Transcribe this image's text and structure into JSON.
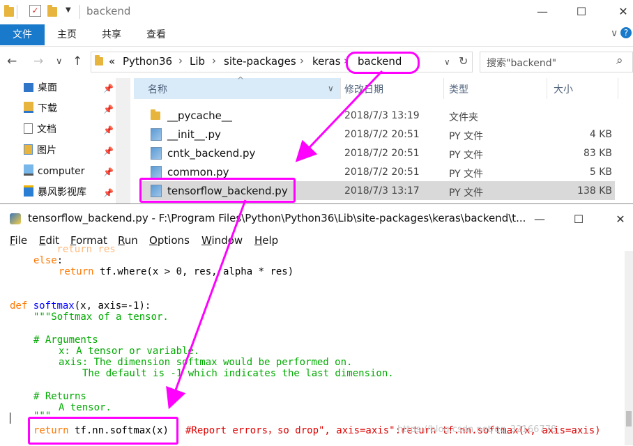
{
  "explorer": {
    "title": "backend",
    "window_controls": [
      "—",
      "☐",
      "✕"
    ],
    "ribbon": {
      "file_tab": "文件",
      "tabs": [
        "主页",
        "共享",
        "查看"
      ],
      "expand": "∨",
      "help": "?"
    },
    "nav": {
      "back": "←",
      "forward": "→",
      "recent": "∨",
      "up": "↑"
    },
    "address": {
      "overflow": "«",
      "crumbs": [
        "Python36",
        "Lib",
        "site-packages",
        "keras",
        "backend"
      ],
      "separator": "›",
      "dropdown": "∨",
      "refresh": "↻"
    },
    "search": {
      "placeholder": "搜索\"backend\"",
      "icon": "⌕"
    },
    "quick_access": [
      {
        "label": "桌面",
        "icon": "desktop-icon"
      },
      {
        "label": "下载",
        "icon": "download-icon"
      },
      {
        "label": "文档",
        "icon": "documents-icon"
      },
      {
        "label": "图片",
        "icon": "pictures-icon"
      },
      {
        "label": "computer",
        "icon": "computer-icon"
      },
      {
        "label": "暴风影视库",
        "icon": "video-library-icon"
      }
    ],
    "pin_glyph": "📌",
    "columns": {
      "name": "名称",
      "modified": "修改日期",
      "type": "类型",
      "size": "大小"
    },
    "files": [
      {
        "name": "__pycache__",
        "date": "2018/7/3 13:19",
        "type": "文件夹",
        "size": "",
        "icon": "folder-icon"
      },
      {
        "name": "__init__.py",
        "date": "2018/7/2 20:51",
        "type": "PY 文件",
        "size": "4 KB",
        "icon": "python-file-icon"
      },
      {
        "name": "cntk_backend.py",
        "date": "2018/7/2 20:51",
        "type": "PY 文件",
        "size": "83 KB",
        "icon": "python-file-icon"
      },
      {
        "name": "common.py",
        "date": "2018/7/2 20:51",
        "type": "PY 文件",
        "size": "5 KB",
        "icon": "python-file-icon"
      },
      {
        "name": "tensorflow_backend.py",
        "date": "2018/7/3 13:17",
        "type": "PY 文件",
        "size": "138 KB",
        "icon": "python-file-icon",
        "selected": true
      }
    ]
  },
  "idle": {
    "title": "tensorflow_backend.py - F:\\Program Files\\Python\\Python36\\Lib\\site-packages\\keras\\backend\\t...",
    "window_controls": [
      "—",
      "☐",
      "✕"
    ],
    "menu": [
      {
        "first": "F",
        "rest": "ile"
      },
      {
        "first": "E",
        "rest": "dit"
      },
      {
        "first": "F",
        "rest": "ormat"
      },
      {
        "first": "R",
        "rest": "un"
      },
      {
        "first": "O",
        "rest": "ptions"
      },
      {
        "first": "W",
        "rest": "indow"
      },
      {
        "first": "H",
        "rest": "elp"
      }
    ],
    "code": {
      "l0": "        return res",
      "l1_kw": "else",
      "l1_rest": ":",
      "l2_kw": "return",
      "l2_rest": " tf.where(x > 0, res, alpha * res)",
      "l3_kw": "def",
      "l3_fn": "softmax",
      "l3_rest": "(x, axis=-1):",
      "l4": "\"\"\"Softmax of a tensor.",
      "l5": "# Arguments",
      "l6": "x: A tensor or variable.",
      "l7": "axis: The dimension softmax would be performed on.",
      "l8": "The default is -1 which indicates the last dimension.",
      "l9": "# Returns",
      "l10": "A tensor.",
      "l11": "\"\"\"",
      "l12_kw": "return",
      "l12_rest": " tf.nn.softmax(x)",
      "l12_comment": "#Report errors，so drop\", axis=axis\":return tf.nn.softmax(x, axis=axis)"
    },
    "watermark": "https://blog.csdn.net/qq_32166778"
  },
  "colors": {
    "annotation": "#ff00ff",
    "file_tab": "#1979ca",
    "keyword": "#ff7700",
    "string": "#00aa00",
    "comment": "#dd0000",
    "definition": "#0000ff"
  }
}
